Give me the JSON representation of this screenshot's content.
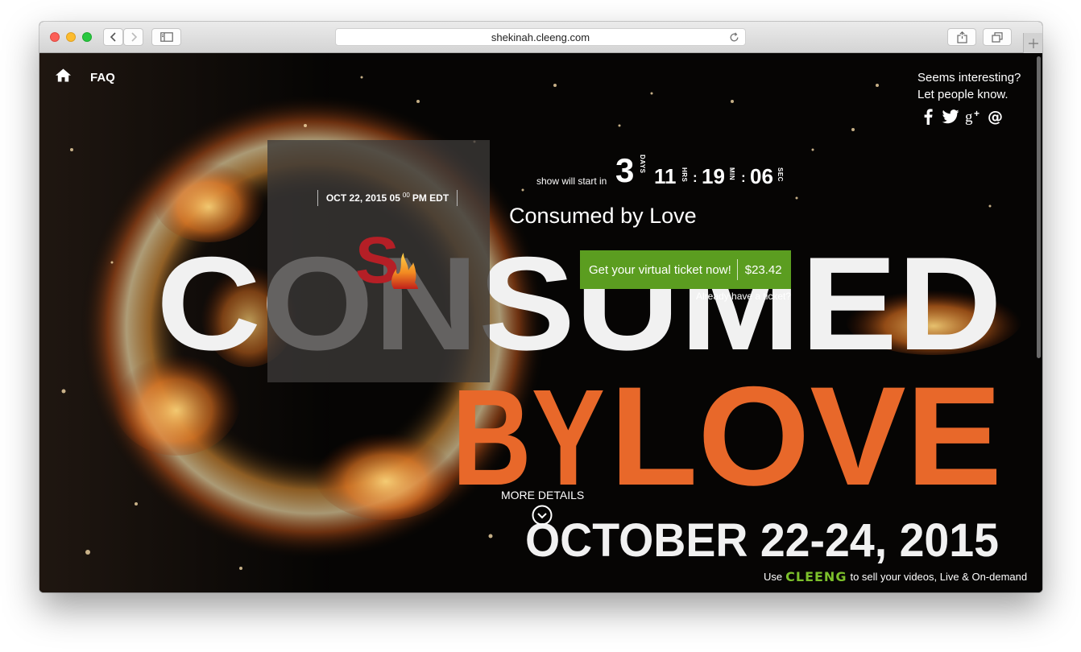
{
  "browser": {
    "url": "shekinah.cleeng.com"
  },
  "nav": {
    "faq_label": "FAQ"
  },
  "share": {
    "text": "Seems interesting? Let people know.",
    "icons": [
      "facebook-icon",
      "twitter-icon",
      "google-plus-icon",
      "email-icon"
    ]
  },
  "event": {
    "date": "OCT 22, 2015 05",
    "date_sup": "00",
    "date_suffix": "PM EDT",
    "title": "Consumed by Love",
    "countdown": {
      "prefix": "show will start in",
      "days": "3",
      "days_label": "DAYS",
      "hours": "11",
      "hours_label": "HRS",
      "minutes": "19",
      "minutes_label": "MIN",
      "seconds": "06",
      "seconds_label": "SEC"
    },
    "buy_label": "Get your virtual ticket now!",
    "price": "$23.42",
    "already_have": "Already have a ticket?",
    "more_details": "MORE DETAILS"
  },
  "poster": {
    "line1": "CONSUMED",
    "line2_a": "BY",
    "line2_b": "LOVE",
    "line3": "OCTOBER 22-24, 2015"
  },
  "footer": {
    "prefix": "Use",
    "brand": "CLEENG",
    "suffix": "to sell your videos, Live & On-demand"
  },
  "colors": {
    "buy_button": "#5b9d20",
    "poster_orange": "#e8682a",
    "brand_green": "#7cc02b"
  }
}
